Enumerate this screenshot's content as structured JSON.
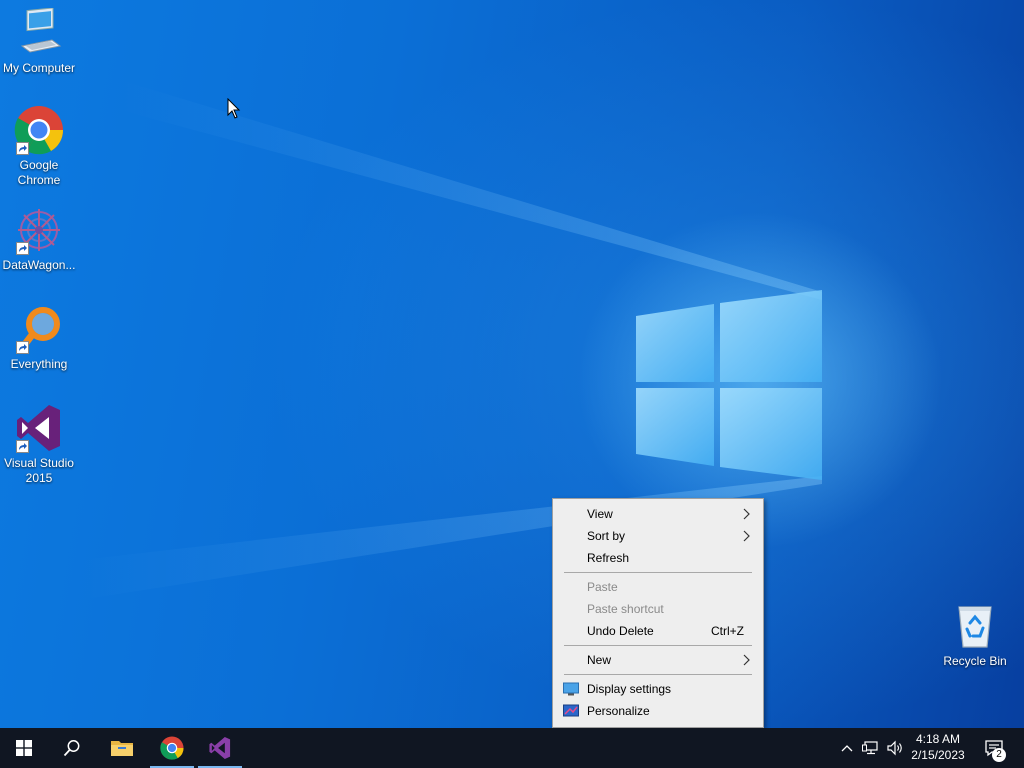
{
  "desktop": {
    "icons": [
      {
        "label": "My Computer",
        "icon": "computer-icon"
      },
      {
        "label": "Google Chrome",
        "icon": "chrome-icon"
      },
      {
        "label": "DataWagon...",
        "icon": "datawagon-icon"
      },
      {
        "label": "Everything",
        "icon": "everything-search-icon"
      },
      {
        "label": "Visual Studio 2015",
        "icon": "visual-studio-icon"
      },
      {
        "label": "Recycle Bin",
        "icon": "recycle-bin-icon"
      }
    ]
  },
  "context_menu": {
    "items": [
      {
        "label": "View",
        "has_submenu": true,
        "enabled": true
      },
      {
        "label": "Sort by",
        "has_submenu": true,
        "enabled": true
      },
      {
        "label": "Refresh",
        "enabled": true
      },
      {
        "label": "Paste",
        "enabled": false
      },
      {
        "label": "Paste shortcut",
        "enabled": false
      },
      {
        "label": "Undo Delete",
        "shortcut": "Ctrl+Z",
        "enabled": true
      },
      {
        "label": "New",
        "has_submenu": true,
        "enabled": true
      },
      {
        "label": "Display settings",
        "icon": "display-icon",
        "enabled": true
      },
      {
        "label": "Personalize",
        "icon": "personalize-icon",
        "enabled": true
      }
    ]
  },
  "taskbar": {
    "pinned": [
      {
        "name": "start",
        "icon": "windows-start-icon"
      },
      {
        "name": "search",
        "icon": "search-icon"
      },
      {
        "name": "file-explorer",
        "icon": "folder-icon"
      },
      {
        "name": "chrome",
        "icon": "chrome-icon"
      },
      {
        "name": "visual-studio",
        "icon": "visual-studio-icon"
      }
    ],
    "clock": {
      "time": "4:18 AM",
      "date": "2/15/2023"
    },
    "notification_count": "2"
  },
  "colors": {
    "desktop_bg": "#0a63c9",
    "taskbar_bg": "#101622",
    "menu_bg": "#eeeeee",
    "menu_disabled_text": "#8a8a8a"
  }
}
